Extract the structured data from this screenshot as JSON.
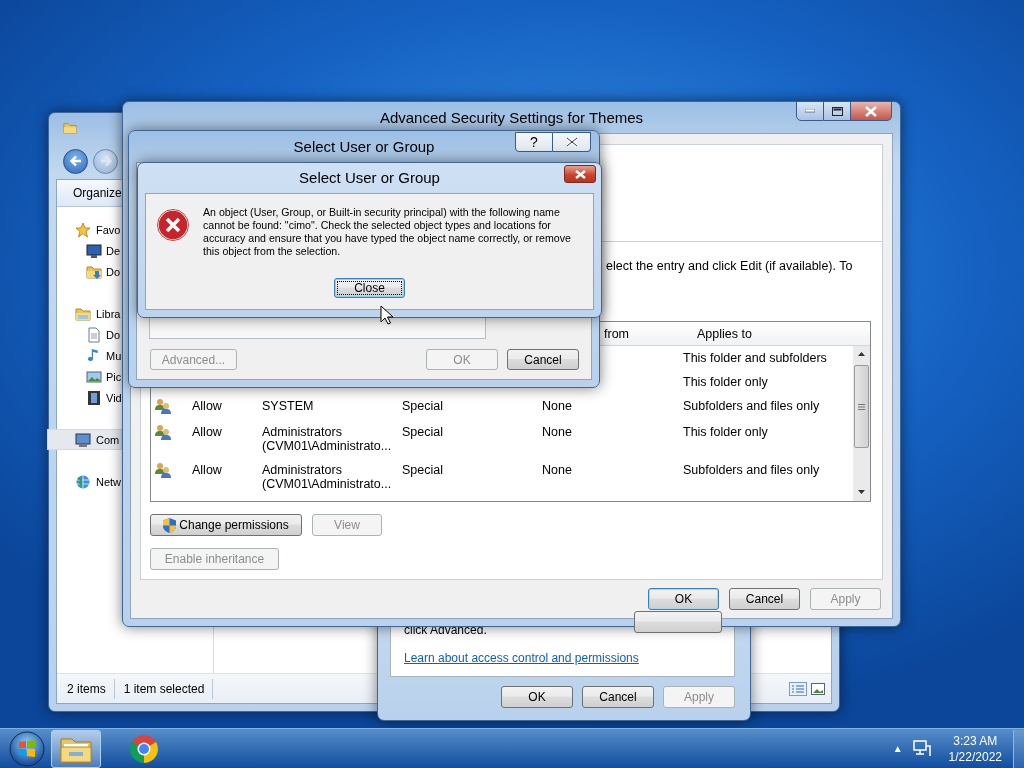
{
  "explorer": {
    "organize": "Organize",
    "nav": [
      {
        "label": "Favo",
        "kind": "star",
        "selected": false,
        "children": [
          {
            "label": "De",
            "kind": "desktop",
            "selected": false
          },
          {
            "label": "Do",
            "kind": "downloads",
            "selected": false
          }
        ]
      },
      {
        "label": "Libra",
        "kind": "library",
        "selected": false,
        "children": [
          {
            "label": "Do",
            "kind": "document",
            "selected": false
          },
          {
            "label": "Mu",
            "kind": "music",
            "selected": false
          },
          {
            "label": "Pic",
            "kind": "pictures",
            "selected": false
          },
          {
            "label": "Vid",
            "kind": "video",
            "selected": false
          }
        ]
      },
      {
        "label": "Com",
        "kind": "computer",
        "selected": true
      },
      {
        "label": "Netw",
        "kind": "network",
        "selected": false
      }
    ],
    "status": [
      "2 items",
      "1 item selected"
    ]
  },
  "properties": {
    "text": "click Advanced.",
    "link": "Learn about access control and permissions",
    "buttons": [
      {
        "label": "OK",
        "disabled": false
      },
      {
        "label": "Cancel",
        "disabled": false
      },
      {
        "label": "Apply",
        "disabled": true
      }
    ]
  },
  "security": {
    "title": "Advanced Security Settings for Themes",
    "instructions": "elect the entry and click Edit (if available). To",
    "columns": [
      {
        "kind": "inherited",
        "label": "from"
      },
      {
        "kind": "applies",
        "label": "Applies to"
      }
    ],
    "rows": [
      {
        "applies": "This folder and subfolders"
      },
      {
        "applies": "This folder only"
      },
      {
        "type": "Allow",
        "principal": "SYSTEM",
        "access": "Special",
        "inherited": "None",
        "applies": "Subfolders and files only"
      },
      {
        "type": "Allow",
        "principal": "Administrators\n(CVM01\\Administrato...",
        "access": "Special",
        "inherited": "None",
        "applies": "This folder only"
      },
      {
        "type": "Allow",
        "principal": "Administrators\n(CVM01\\Administrato...",
        "access": "Special",
        "inherited": "None",
        "applies": "Subfolders and files only"
      }
    ],
    "actions": [
      {
        "label": "Change permissions",
        "shield": true,
        "disabled": false
      },
      {
        "label": "View",
        "shield": false,
        "disabled": true
      },
      {
        "label": "Enable inheritance",
        "shield": false,
        "disabled": true
      }
    ],
    "footer": [
      {
        "label": "OK",
        "disabled": false,
        "default": true
      },
      {
        "label": "Cancel",
        "disabled": false,
        "default": false
      },
      {
        "label": "Apply",
        "disabled": true,
        "default": false
      }
    ]
  },
  "select_dialog": {
    "title": "Select User or Group",
    "help": "?",
    "buttons": [
      {
        "label": "Advanced...",
        "disabled": true
      },
      {
        "label": "OK",
        "disabled": true
      },
      {
        "label": "Cancel",
        "disabled": false
      }
    ]
  },
  "error_dialog": {
    "title": "Select User or Group",
    "message": "An object (User, Group, or Built-in security principal) with the following name cannot be found: \"cimo\". Check the selected object types and locations for accuracy and ensure that you have typed the object name correctly, or remove this object from the selection.",
    "button": "Close"
  },
  "taskbar": {
    "apps": [
      {
        "kind": "explorer",
        "active": true
      },
      {
        "kind": "chrome",
        "active": false
      }
    ],
    "tray_arrow": "▲",
    "time": "3:23 AM",
    "date": "1/22/2022"
  }
}
